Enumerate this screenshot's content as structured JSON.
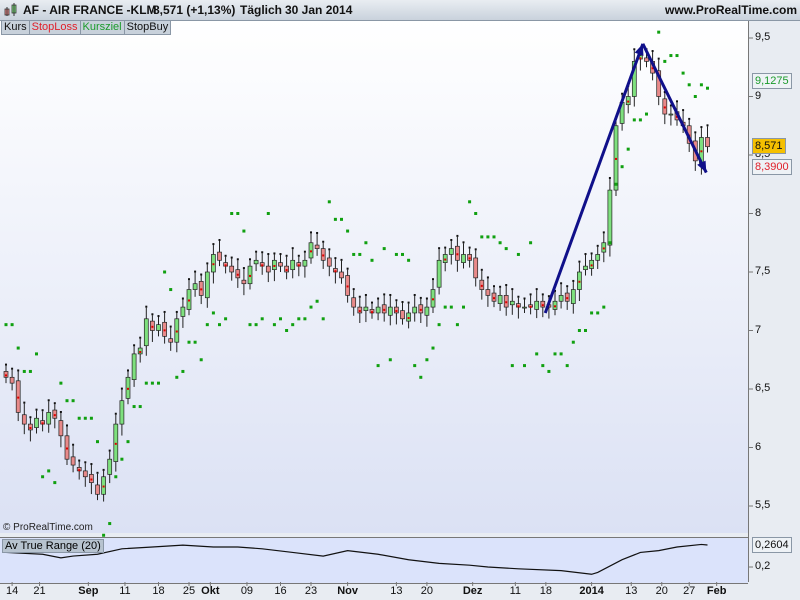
{
  "header": {
    "title": "AF - AIR FRANCE -KLM",
    "price": "8,571 (+1,13%)",
    "period": "Täglich",
    "date": "30 Jan 2014",
    "site": "www.ProRealTime.com"
  },
  "tabs": [
    {
      "label": "Kurs",
      "color": "#111111"
    },
    {
      "label": "StopLoss",
      "color": "#e0202a"
    },
    {
      "label": "Kursziel",
      "color": "#1a9a2a"
    },
    {
      "label": "StopBuy",
      "color": "#111111"
    }
  ],
  "copyright": "© ProRealTime.com",
  "badges": {
    "target": "9,1275",
    "last": "8,571",
    "stop": "8,3900"
  },
  "colors": {
    "up": "#7ee07e",
    "down": "#e88a8a",
    "stopdot": "#10a010",
    "arrow": "#10108a",
    "last": "#f5c000"
  },
  "chart_data": [
    {
      "type": "candlestick",
      "title": "AF - AIR FRANCE -KLM",
      "ylim": [
        5.3,
        9.65
      ],
      "yticks": [
        "9,5",
        "9",
        "8,5",
        "8",
        "7,5",
        "7",
        "6,5",
        "6",
        "5,5"
      ],
      "ytick_values": [
        9.5,
        9,
        8.5,
        8,
        7.5,
        7,
        6.5,
        6,
        5.5
      ],
      "xticks": [
        {
          "label": "14",
          "i": 1
        },
        {
          "label": "21",
          "i": 5.5
        },
        {
          "label": "Sep",
          "i": 13.5,
          "bold": true
        },
        {
          "label": "11",
          "i": 19.5
        },
        {
          "label": "18",
          "i": 25
        },
        {
          "label": "25",
          "i": 30
        },
        {
          "label": "Okt",
          "i": 33.5,
          "bold": true
        },
        {
          "label": "09",
          "i": 39.5
        },
        {
          "label": "16",
          "i": 45
        },
        {
          "label": "23",
          "i": 50
        },
        {
          "label": "Nov",
          "i": 56,
          "bold": true
        },
        {
          "label": "13",
          "i": 64
        },
        {
          "label": "20",
          "i": 69
        },
        {
          "label": "Dez",
          "i": 76.5,
          "bold": true
        },
        {
          "label": "11",
          "i": 83.5
        },
        {
          "label": "18",
          "i": 88.5
        },
        {
          "label": "2014",
          "i": 96,
          "bold": true
        },
        {
          "label": "13",
          "i": 102.5
        },
        {
          "label": "20",
          "i": 107.5
        },
        {
          "label": "27",
          "i": 112
        },
        {
          "label": "Feb",
          "i": 116.5,
          "bold": true
        }
      ],
      "closes": [
        6.6,
        6.55,
        6.3,
        6.2,
        6.15,
        6.25,
        6.2,
        6.3,
        6.25,
        6.1,
        5.9,
        5.85,
        5.8,
        5.75,
        5.7,
        5.6,
        5.75,
        5.9,
        6.2,
        6.4,
        6.6,
        6.8,
        6.85,
        7.1,
        7.0,
        7.05,
        6.95,
        6.9,
        7.1,
        7.2,
        7.35,
        7.4,
        7.3,
        7.5,
        7.65,
        7.6,
        7.55,
        7.5,
        7.45,
        7.4,
        7.55,
        7.6,
        7.55,
        7.5,
        7.6,
        7.55,
        7.5,
        7.6,
        7.55,
        7.6,
        7.75,
        7.7,
        7.6,
        7.55,
        7.5,
        7.45,
        7.3,
        7.2,
        7.15,
        7.2,
        7.15,
        7.2,
        7.15,
        7.2,
        7.15,
        7.1,
        7.15,
        7.2,
        7.15,
        7.2,
        7.35,
        7.6,
        7.65,
        7.7,
        7.6,
        7.65,
        7.6,
        7.45,
        7.35,
        7.3,
        7.25,
        7.3,
        7.2,
        7.25,
        7.2,
        7.2,
        7.2,
        7.25,
        7.2,
        7.2,
        7.25,
        7.3,
        7.25,
        7.35,
        7.5,
        7.55,
        7.6,
        7.65,
        7.75,
        8.2,
        8.75,
        8.95,
        9.0,
        9.3,
        9.35,
        9.3,
        9.2,
        9.0,
        8.85,
        8.85,
        8.8,
        8.75,
        8.6,
        8.45,
        8.65,
        8.571
      ],
      "arrows": [
        [
          [
            88.4,
            7.15
          ],
          [
            104.4,
            9.45
          ]
        ],
        [
          [
            104.4,
            9.45
          ],
          [
            114.8,
            8.35
          ]
        ]
      ],
      "indicator": {
        "name": "Av True Range (20)",
        "label": "Av True Range (20)",
        "last": "0,2604",
        "ytick": "0,2",
        "ytick_value": 0.2,
        "points": [
          [
            0,
            0.24
          ],
          [
            6,
            0.235
          ],
          [
            9,
            0.225
          ],
          [
            11,
            0.23
          ],
          [
            15,
            0.235
          ],
          [
            19,
            0.25
          ],
          [
            24,
            0.255
          ],
          [
            29,
            0.26
          ],
          [
            34,
            0.255
          ],
          [
            38,
            0.255
          ],
          [
            42,
            0.25
          ],
          [
            47,
            0.24
          ],
          [
            52,
            0.23
          ],
          [
            56,
            0.245
          ],
          [
            61,
            0.235
          ],
          [
            66,
            0.22
          ],
          [
            71,
            0.21
          ],
          [
            76,
            0.205
          ],
          [
            79,
            0.2
          ],
          [
            84,
            0.195
          ],
          [
            91,
            0.19
          ],
          [
            96,
            0.18
          ],
          [
            97,
            0.185
          ],
          [
            101,
            0.22
          ],
          [
            104,
            0.24
          ],
          [
            107,
            0.245
          ],
          [
            110,
            0.255
          ],
          [
            114,
            0.262
          ],
          [
            115,
            0.2604
          ]
        ]
      }
    }
  ]
}
